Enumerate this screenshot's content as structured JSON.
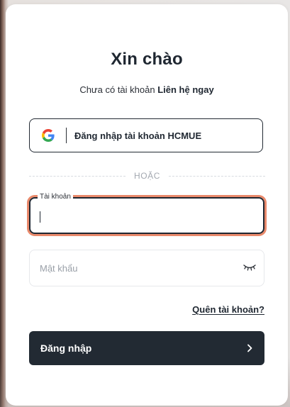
{
  "login": {
    "title": "Xin chào",
    "no_account_text": "Chưa có tài khoản",
    "contact_link": "Liên hệ ngay",
    "google_button_label": "Đăng nhập tài khoản HCMUE",
    "divider_text": "HOẶC",
    "username_label": "Tài khoản",
    "username_value": "",
    "password_placeholder": "Mật khẩu",
    "password_value": "",
    "forgot_link": "Quên tài khoản?",
    "submit_label": "Đăng nhập"
  },
  "icons": {
    "google": "google-icon",
    "password_toggle": "eye-closed-icon",
    "submit": "chevron-right-icon"
  },
  "colors": {
    "primary": "#222a33",
    "focus_ring": "#e9896b",
    "google_blue": "#4285F4",
    "google_red": "#EA4335",
    "google_yellow": "#FBBC05",
    "google_green": "#34A853"
  }
}
